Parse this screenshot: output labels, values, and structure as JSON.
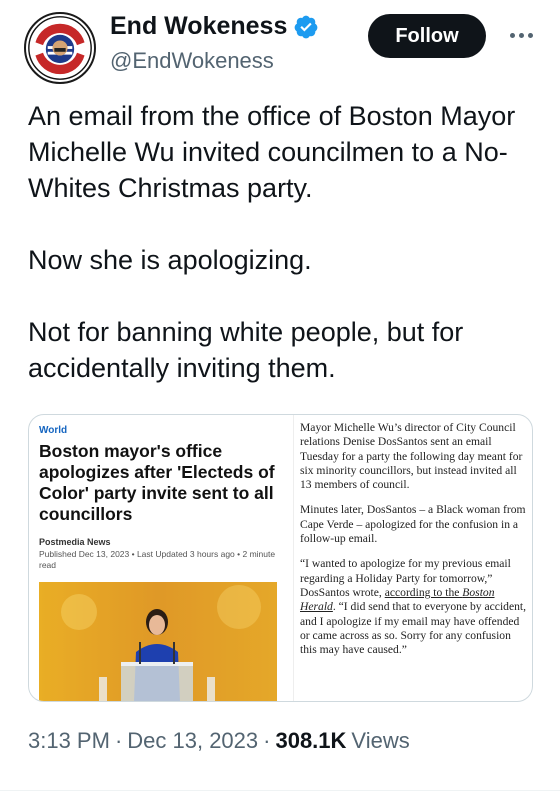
{
  "author": {
    "display_name": "End Wokeness",
    "handle": "@EndWokeness",
    "verified": true,
    "avatar_text_top": "I SUPPORT THE",
    "avatar_text_bottom": "FORMER THINGS"
  },
  "actions": {
    "follow_label": "Follow",
    "more_icon": "more-horizontal-icon"
  },
  "tweet": {
    "paragraphs": [
      "An email from the office of Boston Mayor Michelle Wu invited councilmen to a No-Whites Christmas party.",
      "Now she is apologizing.",
      "Not for banning white people, but for accidentally inviting them."
    ]
  },
  "card": {
    "section": "World",
    "headline": "Boston mayor's office apologizes after 'Electeds of Color' party invite sent to all councillors",
    "source": "Postmedia News",
    "published": "Published Dec 13, 2023 • Last Updated 3 hours ago • 2 minute read",
    "article_p1": "Mayor Michelle Wu’s director of City Council relations Denise DosSantos sent an email Tuesday for a party the following day meant for six minority councillors, but instead invited all 13 members of council.",
    "article_p2": "Minutes later, DosSantos – a Black woman from Cape Verde – apologized for the confusion in a follow-up email.",
    "article_p3_a": "“I wanted to apologize for my previous email regarding a Holiday Party for tomorrow,” DosSantos wrote, ",
    "article_p3_link_a": "according to the ",
    "article_p3_link_b": "Boston Herald",
    "article_p3_b": ". “I did send that to everyone by accident, and I apologize if my email may have offended or came across as so. Sorry for any confusion this may have caused.”"
  },
  "meta": {
    "time": "3:13 PM",
    "sep1": "·",
    "date": "Dec 13, 2023",
    "sep2": "·",
    "views_count": "308.1K",
    "views_label": "Views"
  },
  "colors": {
    "follow_bg": "#0f1419",
    "verified": "#1d9bf0",
    "section_label": "#1565c0",
    "secondary_text": "#536471"
  }
}
